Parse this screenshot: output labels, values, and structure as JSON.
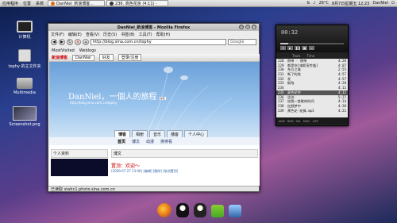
{
  "top_panel": {
    "menus": [
      "应用程序",
      "位置",
      "系统"
    ],
    "tasks": [
      "DanNiel_新浪博客...",
      "236. 高色花余 (4:11) -"
    ],
    "temperature": "26°C",
    "datetime": "8月7日星期五 12:23",
    "user": "DanNiel"
  },
  "desktop_icons": [
    {
      "label": "计算机",
      "icon": "computer-icon"
    },
    {
      "label": "tophy 的主文件夹",
      "icon": "home-folder-icon"
    },
    {
      "label": "Multimedia",
      "icon": "multimedia-folder-icon"
    },
    {
      "label": "Screenshot.png",
      "icon": "image-file-icon"
    }
  ],
  "firefox": {
    "title": "DanNiel_新浪博客 - Mozilla Firefox",
    "menu": [
      "文件(F)",
      "编辑(E)",
      "查看(V)",
      "历史(S)",
      "书签(B)",
      "工具(T)",
      "帮助(H)"
    ],
    "url": "http://blog.sina.com.cn/tophy",
    "search_placeholder": "Google",
    "bookmarks": [
      "MostVisited",
      "Weblogs"
    ],
    "status": "已读取 static1.photo.sina.com.cn"
  },
  "blog": {
    "logo": "新浪博客",
    "bar_buttons": [
      "DanNiel",
      "好友",
      "登录/注册"
    ],
    "name": "DanNiel，一個人的旅程",
    "name_tag": "编辑",
    "url": "http://blog.sina.com.cn/tophy",
    "tabs": [
      "博客",
      "相册",
      "音乐",
      "播客",
      "个人中心"
    ],
    "subnav": [
      "首页",
      "博文",
      "动漫",
      "排排看"
    ],
    "left_header": "个人资料",
    "right_header": "博文",
    "post_title": "置顶：欢迎～",
    "post_meta": "(2009-07-27 13:06) [编辑] [删除] [取消置顶]"
  },
  "player": {
    "time": "00:32",
    "progress": 0.13,
    "headers": [
      "Track",
      "Time"
    ],
    "playlist": [
      {
        "n": "228",
        "t": "倒带 - 倒带",
        "d": "4:28"
      },
      {
        "n": "229",
        "t": "都是你[电影宣传曲]",
        "d": "4:07"
      },
      {
        "n": "230",
        "t": "东方之珠",
        "d": "2:55"
      },
      {
        "n": "231",
        "t": "断了的弦",
        "d": "4:57"
      },
      {
        "n": "232",
        "t": "发",
        "d": "4:57"
      },
      {
        "n": "233",
        "t": "枫残",
        "d": "4:28"
      },
      {
        "n": "234",
        "t": "",
        "d": "4:11"
      },
      {
        "n": "235",
        "t": "高色花余",
        "d": "4:11"
      },
      {
        "n": "236",
        "t": "告别",
        "d": "5:27"
      },
      {
        "n": "237",
        "t": "给我一首歌的时间",
        "d": "4:14"
      },
      {
        "n": "238",
        "t": "红颜梦中",
        "d": "4:20"
      },
      {
        "n": "239",
        "t": "黄色花-花佛.mp3",
        "d": "4:21"
      }
    ],
    "current_index": 7,
    "footer": [
      "ADD",
      "REM",
      "SEL",
      "MISC",
      "LIST"
    ]
  },
  "dock": [
    "firefox-icon",
    "qq-icon",
    "penguin-icon",
    "android-icon",
    "mail-icon"
  ]
}
